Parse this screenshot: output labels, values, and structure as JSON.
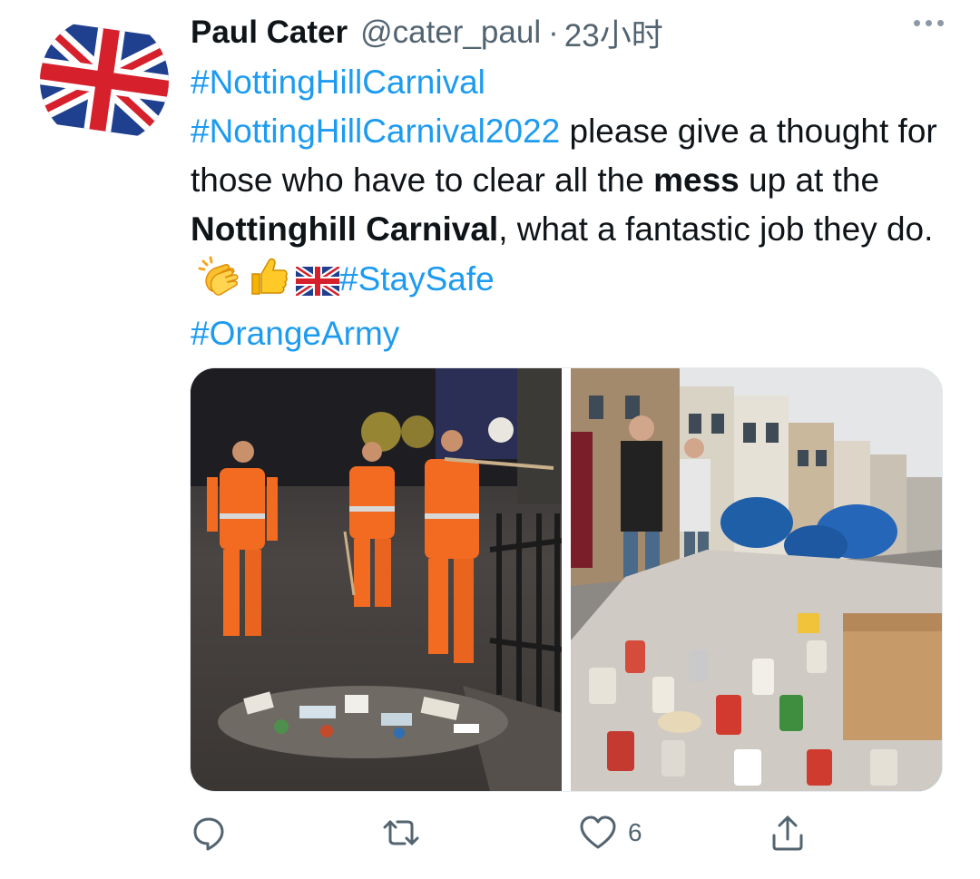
{
  "tweet": {
    "display_name": "Paul Cater",
    "handle": "@cater_paul",
    "separator": "·",
    "time": "23小时",
    "body": {
      "tag1": "#NottingHillCarnival",
      "tag2": "#NottingHillCarnival2022",
      "text1": " please give a thought for those who have to clear all the ",
      "bold1": "mess",
      "text2": " up at the ",
      "bold2": "Nottinghill Carnival",
      "text3": ", what a fantastic job they do. ",
      "tag3": "#StaySafe",
      "tag4": "#OrangeArmy"
    },
    "emojis": [
      "clapping-hands",
      "thumbs-up",
      "uk-flag"
    ],
    "media": [
      {
        "name": "street-cleaners-photo"
      },
      {
        "name": "rubbish-pile-photo"
      }
    ],
    "actions": {
      "reply_count": "",
      "retweet_count": "",
      "like_count": "6",
      "share_count": ""
    }
  },
  "colors": {
    "link": "#1d9bf0",
    "text": "#0f1419",
    "muted": "#536471"
  }
}
